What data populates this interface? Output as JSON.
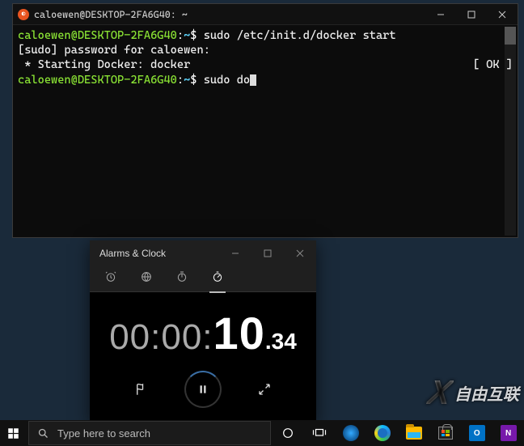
{
  "terminal": {
    "title": "caloewen@DESKTOP-2FA6G40: ~",
    "prompt_host": "caloewen@DESKTOP-2FA6G40",
    "prompt_sep": ":",
    "prompt_path": "~",
    "prompt_sym": "$",
    "line1_cmd": "sudo /etc/init.d/docker start",
    "line2": "[sudo] password for caloewen:",
    "line3": " * Starting Docker: docker",
    "line3_status": "[ OK ]",
    "line4_cmd": "sudo do"
  },
  "clock": {
    "title": "Alarms & Clock",
    "tabs": [
      "alarm",
      "world-clock",
      "timer",
      "stopwatch"
    ],
    "active_tab_index": 3,
    "timer_main": "00:00:",
    "timer_seconds": "10",
    "timer_frac": ".34",
    "ctrl_flag": "flag",
    "ctrl_pause": "pause",
    "ctrl_expand": "expand"
  },
  "watermark": {
    "brand_x": "X",
    "text": "自由互联"
  },
  "taskbar": {
    "search_placeholder": "Type here to search",
    "apps": [
      "edge",
      "file-explorer",
      "microsoft-store",
      "outlook",
      "onenote"
    ]
  }
}
